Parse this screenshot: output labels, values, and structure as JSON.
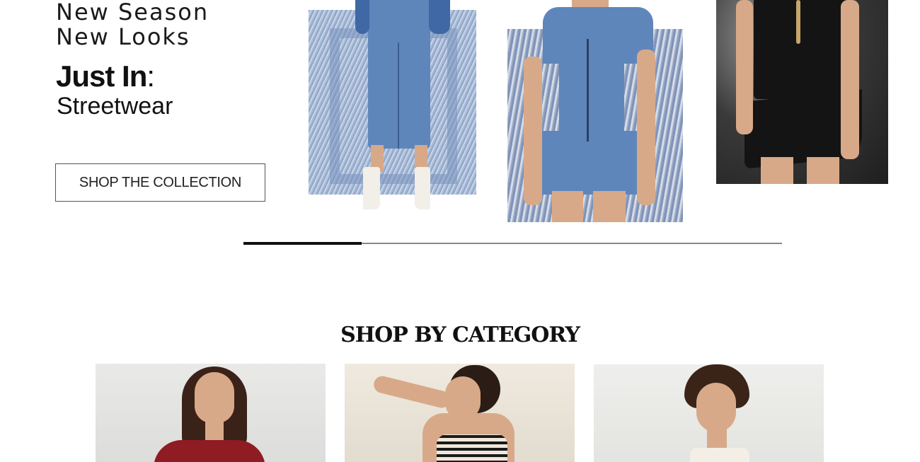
{
  "hero": {
    "line1": "New Season",
    "line2": "New Looks",
    "just_in": "Just In",
    "colon": ":",
    "subtitle": "Streetwear",
    "cta_label": "SHOP THE COLLECTION"
  },
  "products": [
    {
      "name": "denim-shirt-dress"
    },
    {
      "name": "denim-zip-mini-dress"
    },
    {
      "name": "black-ruffle-dress"
    }
  ],
  "carousel": {
    "progress_fraction": 0.22
  },
  "category_section": {
    "title": "SHOP BY CATEGORY"
  },
  "colors": {
    "text": "#111111",
    "track": "#888888",
    "thumb": "#111111"
  }
}
